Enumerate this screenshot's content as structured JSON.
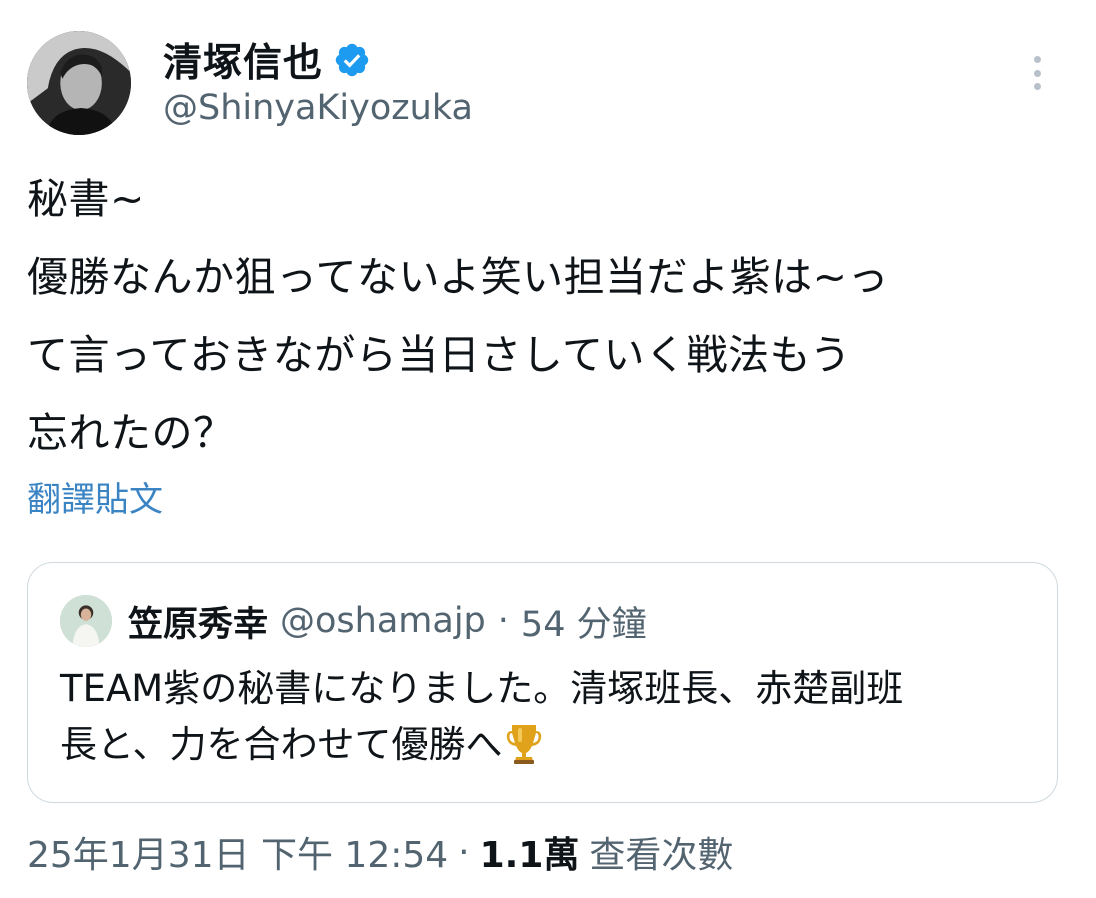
{
  "author": {
    "display_name": "清塚信也",
    "handle": "@ShinyaKiyozuka",
    "verified": true,
    "verified_color": "#1d9bf0",
    "avatar_icon": "profile-photo"
  },
  "tweet": {
    "lines": [
      "秘書~",
      "優勝なんか狙ってないよ笑い担当だよ紫は~っ",
      "て言っておきながら当日さしていく戦法もう",
      "忘れたの？"
    ],
    "translate_label": "翻譯貼文"
  },
  "quote": {
    "display_name": "笠原秀幸",
    "handle": "@oshamajp",
    "separator": "·",
    "time": "54 分鐘",
    "lines": [
      "TEAM紫の秘書になりました。清塚班長、赤楚副班",
      "長と、力を合わせて優勝へ"
    ],
    "emoji_icon": "trophy-icon"
  },
  "meta": {
    "timestamp": "25年1月31日 下午 12:54",
    "separator": "·",
    "views_count": "1.1萬",
    "views_label": "查看次數"
  },
  "colors": {
    "text_primary": "#0f1419",
    "text_secondary": "#536471",
    "link": "#3b84c4",
    "border": "#cfd9de"
  }
}
